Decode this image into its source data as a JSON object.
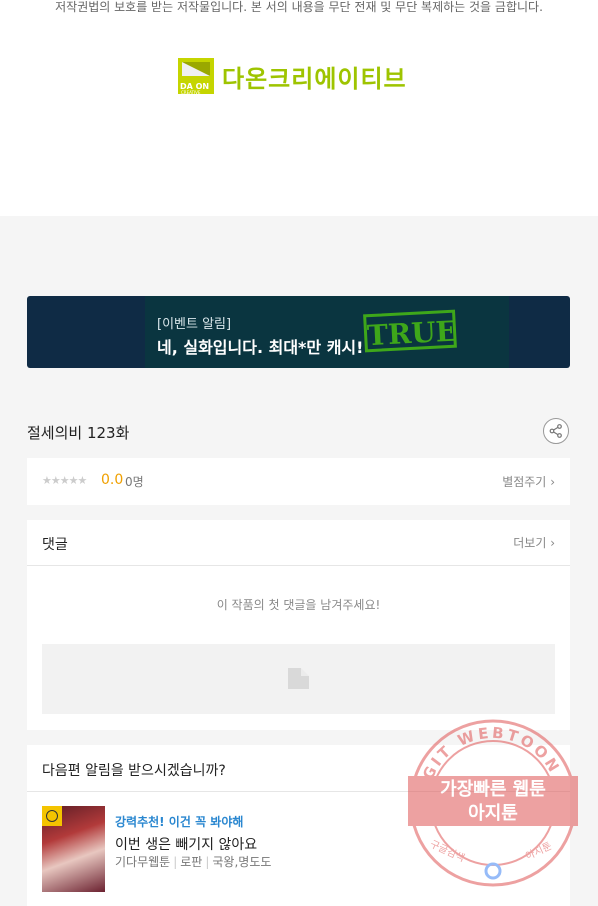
{
  "copyright": "저작권법의 보호를 받는 저작물입니다. 본 서의 내용을 무단 전재 및 무단 복제하는 것을 금합니다.",
  "publisher": {
    "logo_mark_text": "DA ON",
    "logo_mark_sub": "CREATIVE",
    "name": "다온크리에이티브"
  },
  "banner": {
    "tag": "[이벤트 알림]",
    "title": "네, 실화입니다. 최대*만 캐시!",
    "stamp": "TRUE"
  },
  "episode": {
    "title": "절세의비 123화"
  },
  "rating": {
    "stars": "★★★★★",
    "score": "0.0",
    "count": "0명",
    "rate_link": "별점주기"
  },
  "comments": {
    "title": "댓글",
    "more": "더보기",
    "empty": "이 작품의 첫 댓글을 남겨주세요!"
  },
  "notify": {
    "title": "다음편 알림을 받으시겠습니까?",
    "recommend_tag": "강력추천! 이건 꼭 봐야해",
    "recommend_title": "이번 생은 빼기지 않아요",
    "genres": [
      "기다무웹툰",
      "로판",
      "국왕,명도도"
    ]
  },
  "watermark": {
    "ring_text": "AGIT WEBTOON",
    "line1": "가장빠른 웹툰",
    "line2": "아지툰",
    "bottom_left": "구글검색",
    "bottom_right": "아지툰"
  },
  "colors": {
    "accent_score": "#f0a000",
    "accent_link": "#2a87d0",
    "banner_bg": "#0f2b45",
    "stamp_green": "#3ea71a",
    "logo_green": "#9ec400"
  }
}
